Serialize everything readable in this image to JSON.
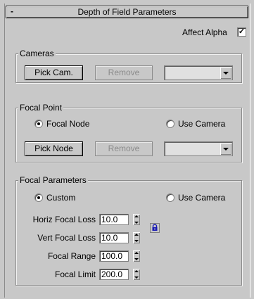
{
  "rollout": {
    "title": "Depth of Field Parameters",
    "collapse_symbol": "-"
  },
  "affect_alpha": {
    "label": "Affect Alpha",
    "checked": true,
    "mark": "✓"
  },
  "cameras": {
    "title": "Cameras",
    "pick_label": "Pick Cam.",
    "remove_label": "Remove",
    "dropdown_value": ""
  },
  "focal_point": {
    "title": "Focal Point",
    "options": [
      "Focal Node",
      "Use Camera"
    ],
    "selected": "Focal Node",
    "pick_label": "Pick Node",
    "remove_label": "Remove",
    "dropdown_value": ""
  },
  "focal_parameters": {
    "title": "Focal Parameters",
    "options": [
      "Custom",
      "Use Camera"
    ],
    "selected": "Custom",
    "fields": [
      {
        "label": "Horiz Focal Loss",
        "value": "10.0"
      },
      {
        "label": "Vert Focal Loss",
        "value": "10.0"
      },
      {
        "label": "Focal Range",
        "value": "100.0"
      },
      {
        "label": "Focal Limit",
        "value": "200.0"
      }
    ],
    "lock_icon": "lock-icon"
  },
  "colors": {
    "panel_bg": "#c8c8c8",
    "disabled_text": "#8a8a8a",
    "lock_blue": "#1a1ab4"
  }
}
